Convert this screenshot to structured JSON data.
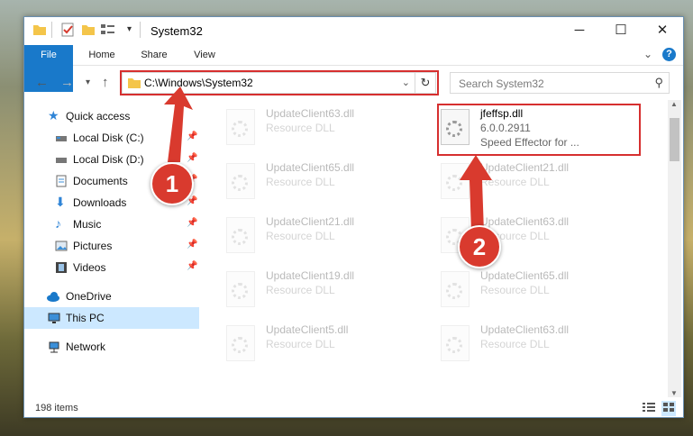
{
  "window": {
    "title": "System32",
    "minimize": "─",
    "maximize": "☐",
    "close": "✕",
    "help": "?",
    "chevron": "⌄"
  },
  "ribbon": {
    "tabs": [
      "File",
      "Home",
      "Share",
      "View"
    ]
  },
  "address": {
    "path": "C:\\Windows\\System32"
  },
  "search": {
    "placeholder": "Search System32"
  },
  "sidebar": {
    "items": [
      {
        "label": "Quick access"
      },
      {
        "label": "Local Disk (C:)"
      },
      {
        "label": "Local Disk (D:)"
      },
      {
        "label": "Documents"
      },
      {
        "label": "Downloads"
      },
      {
        "label": "Music"
      },
      {
        "label": "Pictures"
      },
      {
        "label": "Videos"
      },
      {
        "label": "OneDrive"
      },
      {
        "label": "This PC"
      },
      {
        "label": "Network"
      }
    ]
  },
  "files": [
    {
      "name": "UpdateClient63.dll",
      "desc": "Resource DLL"
    },
    {
      "name": "jfeffsp.dll",
      "version": "6.0.0.2911",
      "desc": "Speed Effector for ..."
    },
    {
      "name": "UpdateClient65.dll",
      "desc": "Resource DLL"
    },
    {
      "name": "UpdateClient21.dll",
      "desc": "Resource DLL"
    },
    {
      "name": "UpdateClient21.dll",
      "desc": "Resource DLL"
    },
    {
      "name": "UpdateClient63.dll",
      "desc": "Resource DLL"
    },
    {
      "name": "UpdateClient19.dll",
      "desc": "Resource DLL"
    },
    {
      "name": "UpdateClient65.dll",
      "desc": "Resource DLL"
    },
    {
      "name": "UpdateClient5.dll",
      "desc": "Resource DLL"
    },
    {
      "name": "UpdateClient63.dll",
      "desc": "Resource DLL"
    }
  ],
  "status": {
    "items": "198 items"
  },
  "annotations": {
    "step1": "1",
    "step2": "2"
  },
  "colors": {
    "accent": "#1979ca",
    "highlight": "#d62f2f",
    "selection": "#cce8ff"
  }
}
